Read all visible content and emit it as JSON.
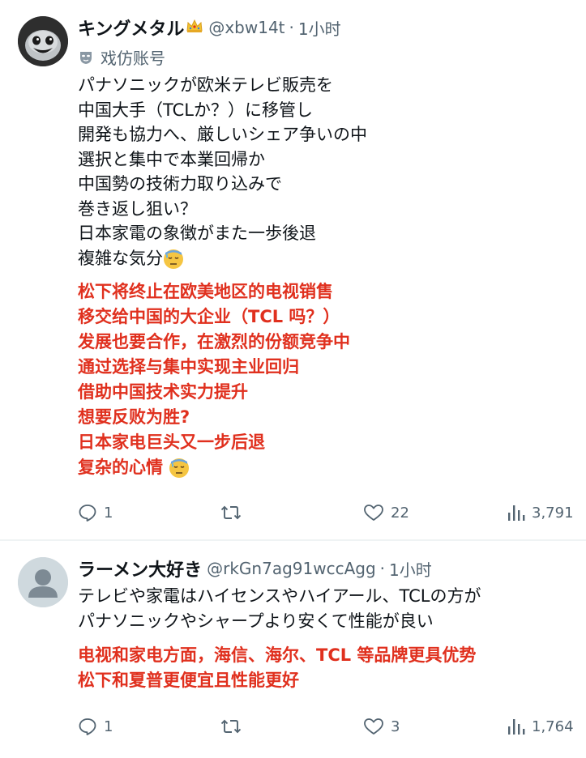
{
  "tweets": [
    {
      "author_name": "キングメタル",
      "handle": "@xbw14t",
      "separator": "·",
      "time": "1小时",
      "account_label": "戏仿账号",
      "text_jp": [
        "パナソニックが欧米テレビ販売を",
        "中国大手（TCLか？）に移管し",
        "開発も協力へ、厳しいシェア争いの中",
        "選択と集中で本業回帰か",
        "中国勢の技術力取り込みで",
        "巻き返し狙い？",
        "日本家電の象徴がまた一歩後退",
        "複雑な気分"
      ],
      "text_cn": [
        "松下将终止在欧美地区的电视销售",
        "移交给中国的大企业（TCL 吗？）",
        "发展也要合作，在激烈的份额竞争中",
        "通过选择与集中实现主业回归",
        "借助中国技术实力提升",
        "想要反败为胜?",
        "日本家电巨头又一步后退",
        "复杂的心情"
      ],
      "replies": "1",
      "likes": "22",
      "views": "3,791"
    },
    {
      "author_name": "ラーメン大好き",
      "handle": "@rkGn7ag91wccAgg",
      "separator": "·",
      "time": "1小时",
      "text_jp": [
        "テレビや家電はハイセンスやハイアール、TCLの方が",
        "パナソニックやシャープより安くて性能が良い"
      ],
      "text_cn": [
        "电视和家电方面，海信、海尔、TCL 等品牌更具优势",
        "松下和夏普更便宜且性能更好"
      ],
      "replies": "1",
      "likes": "3",
      "views": "1,764"
    }
  ],
  "icons": {
    "verified": "crown-icon",
    "label": "mask-icon",
    "emoji": "sweat-face-emoji",
    "reply": "reply-icon",
    "retweet": "retweet-icon",
    "like": "heart-icon",
    "views": "bar-chart-icon"
  },
  "colors": {
    "translation_text": "#e0301e",
    "secondary_text": "#536471",
    "primary_text": "#0f1419"
  }
}
